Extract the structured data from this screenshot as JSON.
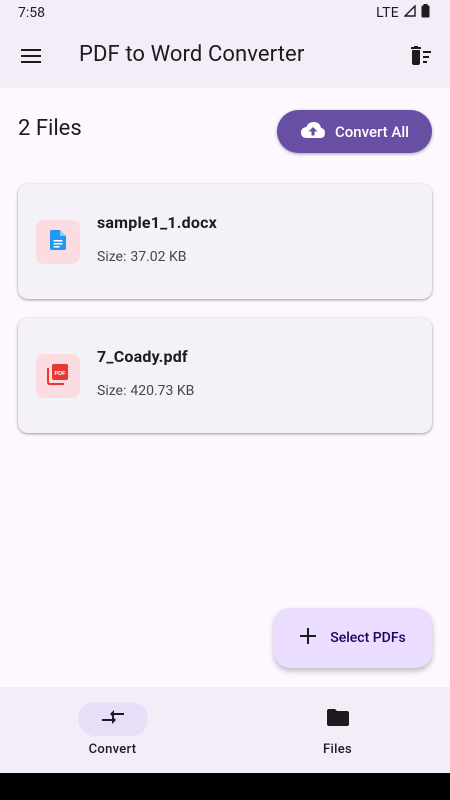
{
  "status_bar": {
    "time": "7:58",
    "network": "LTE"
  },
  "app_bar": {
    "title": "PDF to Word Converter",
    "menu_icon": "menu-icon",
    "delete_icon": "delete-sweep-icon"
  },
  "header": {
    "files_count": "2 Files",
    "convert_all_label": "Convert All",
    "convert_all_icon": "cloud-upload-icon"
  },
  "files": [
    {
      "name": "sample1_1.docx",
      "size_label": "Size:",
      "size": "37.02 KB",
      "icon": "document-icon",
      "icon_color": "#2196f3"
    },
    {
      "name": "7_Coady.pdf",
      "size_label": "Size:",
      "size": "420.73 KB",
      "icon": "pdf-icon",
      "icon_color": "#e53935"
    }
  ],
  "fab": {
    "label": "Select PDFs",
    "icon": "plus-icon"
  },
  "bottom_nav": {
    "items": [
      {
        "label": "Convert",
        "icon": "compare-arrows-icon",
        "active": true
      },
      {
        "label": "Files",
        "icon": "folder-icon",
        "active": false
      }
    ]
  },
  "colors": {
    "primary": "#6750a4",
    "surface": "#fdf7ff",
    "surface_container": "#f3edf7",
    "fab_container": "#eaddff",
    "nav_indicator": "#e8def8",
    "thumb_background": "#fbdde1"
  }
}
